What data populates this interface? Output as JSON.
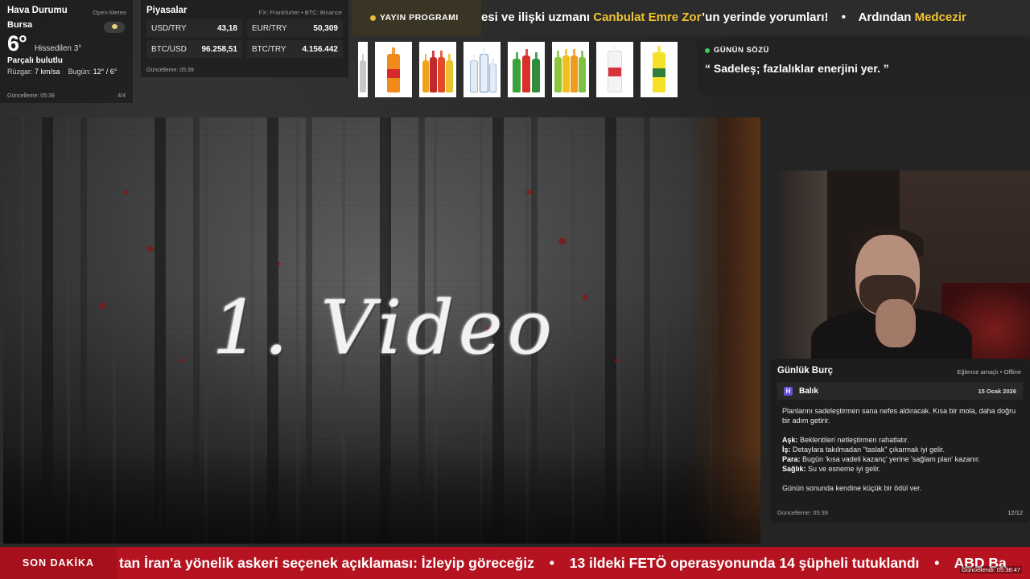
{
  "weather": {
    "title": "Hava Durumu",
    "source": "Open-Meteo",
    "city": "Bursa",
    "temperature": "6°",
    "feels_like": "Hissedilen 3°",
    "condition": "Parçalı bulutlu",
    "wind_label": "Rüzgar:",
    "wind_value": "7 km/sa",
    "today_label": "Bugün:",
    "today_value": "12° / 6°",
    "updated": "Güncelleme: 05:39",
    "page": "4/4",
    "icon": "partly-cloudy-icon"
  },
  "markets": {
    "title": "Piyasalar",
    "source": "FX: Frankfurter • BTC: Binance",
    "rates": [
      {
        "pair": "USD/TRY",
        "value": "43,18"
      },
      {
        "pair": "EUR/TRY",
        "value": "50,309"
      },
      {
        "pair": "BTC/USD",
        "value": "96.258,51"
      },
      {
        "pair": "BTC/TRY",
        "value": "4.156.442"
      }
    ],
    "updated": "Güncelleme: 05:39"
  },
  "top_ticker": {
    "badge": "YAYIN PROGRAMI",
    "segments": [
      {
        "text": "esi ve ilişki uzmanı ",
        "highlight": false
      },
      {
        "text": "Canbulat Emre Zor",
        "highlight": true
      },
      {
        "text": "’un yerinde yorumları!",
        "highlight": false
      }
    ],
    "separator": "•",
    "next_text": "Ardından ",
    "next_highlight": "Medcezir"
  },
  "quote": {
    "title": "GÜNÜN SÖZÜ",
    "text": "“ Sadeleş; fazlalıklar enerjini yer. ”"
  },
  "video": {
    "headline": "1. Video"
  },
  "horoscope": {
    "title": "Günlük Burç",
    "meta": "Eğlence amaçlı • Offline",
    "sign_icon": "H",
    "sign": "Balık",
    "date": "15 Ocak 2026",
    "intro": "Planlarını sadeleştirmen sana nefes aldıracak. Kısa bir mola, daha doğru bir adım getirir.",
    "love_label": "Aşk:",
    "love": "Beklentileri netleştirmen rahatlatır.",
    "work_label": "İş:",
    "work": "Detaylara takılmadan \"taslak\" çıkarmak iyi gelir.",
    "money_label": "Para:",
    "money": "Bugün 'kısa vadeli kazanç' yerine 'sağlam plan' kazanır.",
    "health_label": "Sağlık:",
    "health": "Su ve esneme iyi gelir.",
    "outro": "Günün sonunda kendine küçük bir ödül ver.",
    "updated": "Güncelleme: 05:39",
    "page": "12/12"
  },
  "bottom_ticker": {
    "badge": "SON DAKİKA",
    "items": [
      "tan İran'a yönelik askeri seçenek açıklaması: İzleyip göreceğiz",
      "13 ildeki FETÖ operasyonunda 14 şüpheli tutuklandı",
      "ABD Ba"
    ],
    "separator": "•",
    "updated": "Güncellendi: 05:38:47"
  },
  "products": [
    {
      "name": "orange-soda-bottle"
    },
    {
      "name": "mixed-soda-bottles"
    },
    {
      "name": "water-bottles"
    },
    {
      "name": "green-soda-bottles"
    },
    {
      "name": "fruit-soda-bottles"
    },
    {
      "name": "clear-soda-bottle"
    },
    {
      "name": "yellow-soda-bottle"
    }
  ]
}
